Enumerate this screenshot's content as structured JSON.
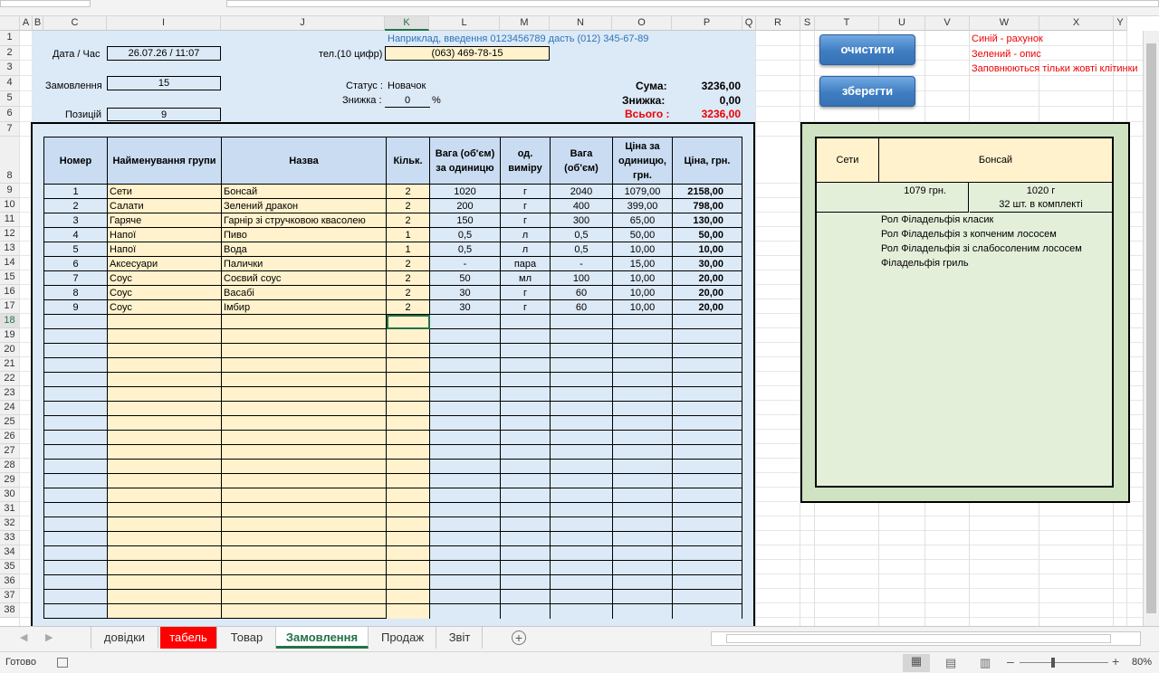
{
  "columns": [
    "A",
    "B",
    "C",
    "I",
    "J",
    "K",
    "L",
    "M",
    "N",
    "O",
    "P",
    "Q",
    "R",
    "S",
    "T",
    "U",
    "V",
    "W",
    "X",
    "Y"
  ],
  "rows": [
    "1",
    "2",
    "3",
    "4",
    "5",
    "6",
    "7",
    "8",
    "9",
    "10",
    "11",
    "12",
    "13",
    "14",
    "15",
    "16",
    "17",
    "18",
    "19",
    "20",
    "21",
    "22",
    "23",
    "24",
    "25",
    "26",
    "27",
    "28",
    "29",
    "30",
    "31",
    "32",
    "33",
    "34",
    "35",
    "36",
    "37",
    "38"
  ],
  "header": {
    "example_note": "Наприклад, введення 0123456789 дасть (012) 345-67-89",
    "date_label": "Дата / Час",
    "date_value": "26.07.26 / 11:07",
    "phone_label": "тел.(10 цифр)",
    "phone_value": "(063) 469-78-15",
    "order_label": "Замовлення",
    "order_value": "15",
    "status_label": "Статус :",
    "status_value": "Новачок",
    "discount_label": "Знижка :",
    "discount_value": "0",
    "discount_unit": "%",
    "positions_label": "Позицій",
    "positions_value": "9",
    "sum_label": "Сума:",
    "sum_value": "3236,00",
    "disc_label": "Знижка:",
    "disc_value": "0,00",
    "total_label": "Всього :",
    "total_value": "3236,00"
  },
  "table": {
    "headers": [
      "Номер",
      "Найменування групи",
      "Назва",
      "Кільк.",
      "Вага (об'єм) за одиницю",
      "од. виміру",
      "Вага (об'єм)",
      "Ціна за одиницю, грн.",
      "Ціна, грн."
    ],
    "rows": [
      [
        "1",
        "Сети",
        "Бонсай",
        "2",
        "1020",
        "г",
        "2040",
        "1079,00",
        "2158,00"
      ],
      [
        "2",
        "Салати",
        "Зелений дракон",
        "2",
        "200",
        "г",
        "400",
        "399,00",
        "798,00"
      ],
      [
        "3",
        "Гаряче",
        "Гарнір зі стручковою квасолею",
        "2",
        "150",
        "г",
        "300",
        "65,00",
        "130,00"
      ],
      [
        "4",
        "Напої",
        "Пиво",
        "1",
        "0,5",
        "л",
        "0,5",
        "50,00",
        "50,00"
      ],
      [
        "5",
        "Напої",
        "Вода",
        "1",
        "0,5",
        "л",
        "0,5",
        "10,00",
        "10,00"
      ],
      [
        "6",
        "Аксесуари",
        "Палички",
        "2",
        "-",
        "пара",
        "-",
        "15,00",
        "30,00"
      ],
      [
        "7",
        "Соус",
        "Соєвий соус",
        "2",
        "50",
        "мл",
        "100",
        "10,00",
        "20,00"
      ],
      [
        "8",
        "Соус",
        "Васабі",
        "2",
        "30",
        "г",
        "60",
        "10,00",
        "20,00"
      ],
      [
        "9",
        "Соус",
        "Імбир",
        "2",
        "30",
        "г",
        "60",
        "10,00",
        "20,00"
      ]
    ],
    "empty_rows": 21
  },
  "buttons": {
    "clear": "очистити",
    "save": "зберегти"
  },
  "notes": [
    "Синій - рахунок",
    "Зелений - опис",
    "Заповнюються тільки жовті клітинки"
  ],
  "side_panel": {
    "group": "Сети",
    "name": "Бонсай",
    "price": "1079  грн.",
    "weight": "1020  г",
    "pieces": "32 шт.  в комплекті",
    "items": [
      "Рол Філадельфія класик",
      "Рол Філадельфія з копченим лососем",
      "Рол Філадельфія зі слабосоленим лососем",
      "Філадельфія гриль"
    ]
  },
  "tabs": [
    {
      "label": "довідки",
      "state": "normal"
    },
    {
      "label": "табель",
      "state": "red"
    },
    {
      "label": "Товар",
      "state": "normal"
    },
    {
      "label": "Замовлення",
      "state": "active"
    },
    {
      "label": "Продаж",
      "state": "normal"
    },
    {
      "label": "Звіт",
      "state": "normal"
    }
  ],
  "status_bar": {
    "ready": "Готово",
    "zoom": "80%"
  }
}
